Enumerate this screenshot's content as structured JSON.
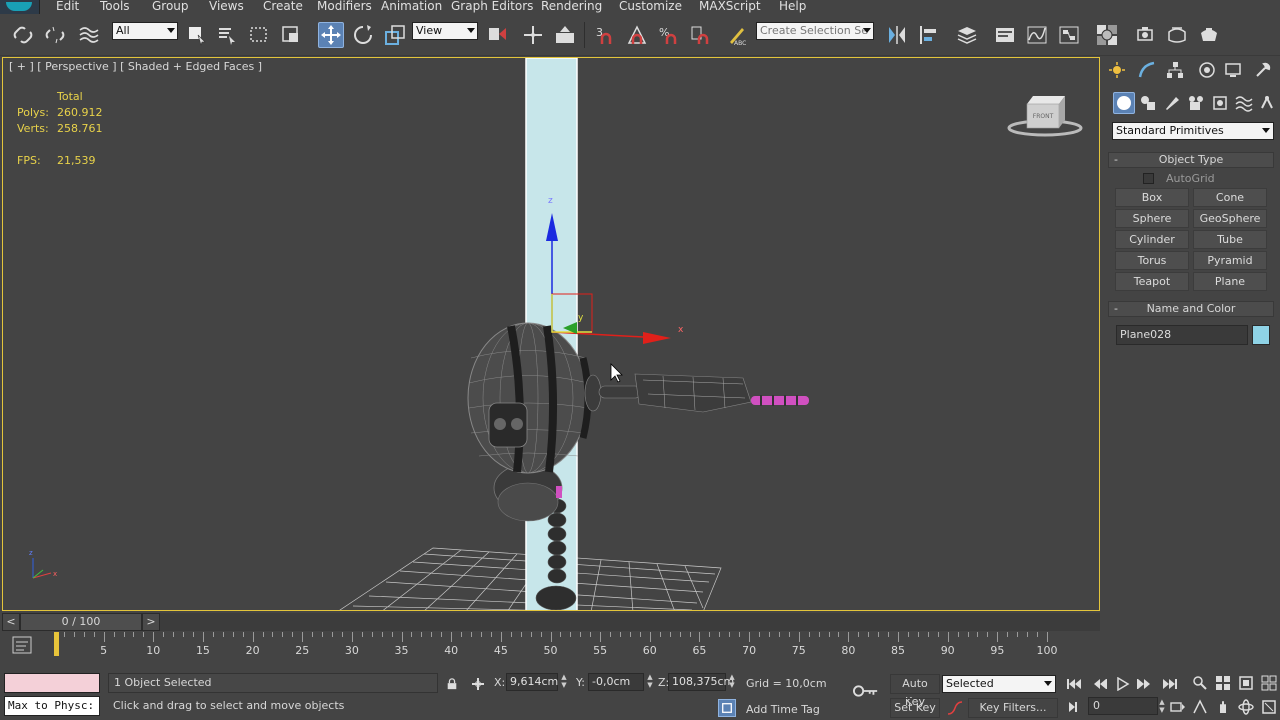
{
  "menu": [
    {
      "label": "Edit",
      "name": "menu-edit"
    },
    {
      "label": "Tools",
      "name": "menu-tools"
    },
    {
      "label": "Group",
      "name": "menu-group"
    },
    {
      "label": "Views",
      "name": "menu-views"
    },
    {
      "label": "Create",
      "name": "menu-create"
    },
    {
      "label": "Modifiers",
      "name": "menu-modifiers"
    },
    {
      "label": "Animation",
      "name": "menu-animation"
    },
    {
      "label": "Graph Editors",
      "name": "menu-graph-editors"
    },
    {
      "label": "Rendering",
      "name": "menu-rendering"
    },
    {
      "label": "Customize",
      "name": "menu-customize"
    },
    {
      "label": "MAXScript",
      "name": "menu-maxscript"
    },
    {
      "label": "Help",
      "name": "menu-help"
    }
  ],
  "toolbar": {
    "selection_filter": "All",
    "ref_coord": "View",
    "named_selection": "Create Selection Se"
  },
  "viewport": {
    "label": "[ + ] [ Perspective ] [ Shaded + Edged Faces ]",
    "stats": {
      "total_label": "Total",
      "polys_label": "Polys:",
      "polys_value": "260.912",
      "verts_label": "Verts:",
      "verts_value": "258.761",
      "fps_label": "FPS:",
      "fps_value": "21,539"
    },
    "viewcube_label": "FRONT",
    "gizmo_labels": {
      "y": "y",
      "x": "x",
      "z": "z"
    }
  },
  "command_panel": {
    "category": "Standard Primitives",
    "object_type": {
      "title": "Object Type",
      "autogrid": "AutoGrid",
      "buttons": [
        "Box",
        "Cone",
        "Sphere",
        "GeoSphere",
        "Cylinder",
        "Tube",
        "Torus",
        "Pyramid",
        "Teapot",
        "Plane"
      ]
    },
    "name_color": {
      "title": "Name and Color",
      "object_name": "Plane028",
      "color": "#8fd3e6"
    }
  },
  "timeline": {
    "position": "0 / 100",
    "prev": "<",
    "next": ">",
    "ticks": [
      "5",
      "10",
      "15",
      "20",
      "25",
      "30",
      "35",
      "40",
      "45",
      "50",
      "55",
      "60",
      "65",
      "70",
      "75",
      "80",
      "85",
      "90",
      "95",
      "100"
    ]
  },
  "status": {
    "maxscript": "Max to Physc:",
    "selection": "1 Object Selected",
    "prompt": "Click and drag to select and move objects",
    "x_label": "X:",
    "x_value": "9,614cm",
    "y_label": "Y:",
    "y_value": "-0,0cm",
    "z_label": "Z:",
    "z_value": "108,375cm",
    "grid": "Grid = 10,0cm",
    "add_time_tag": "Add Time Tag",
    "auto_key": "Auto Key",
    "set_key": "Set Key",
    "key_mode": "Selected",
    "key_filters": "Key Filters...",
    "current_frame": "0"
  },
  "colors": {
    "viewport_border": "#e3c53b",
    "stats_text": "#e8d24a",
    "active_button": "#5b82b4",
    "gizmo_x": "#e0201a",
    "gizmo_y": "#2aa02a",
    "gizmo_z": "#1a2ae0"
  }
}
